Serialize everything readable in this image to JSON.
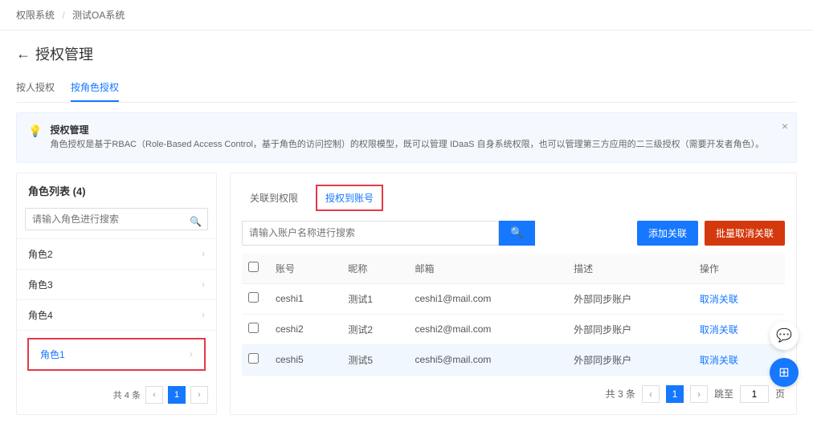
{
  "breadcrumb": {
    "item1": "权限系统",
    "item2": "测试OA系统"
  },
  "header": {
    "title": "授权管理",
    "tabs": {
      "byPerson": "按人授权",
      "byRole": "按角色授权"
    }
  },
  "info": {
    "title": "授权管理",
    "body": "角色授权是基于RBAC（Role-Based Access Control，基于角色的访问控制）的权限模型，既可以管理 IDaaS 自身系统权限，也可以管理第三方应用的二三级授权（需要开发者角色）。"
  },
  "roles": {
    "title": "角色列表",
    "count": "(4)",
    "searchPlaceholder": "请输入角色进行搜索",
    "items": [
      {
        "name": "角色2"
      },
      {
        "name": "角色3"
      },
      {
        "name": "角色4"
      },
      {
        "name": "角色1"
      }
    ],
    "total": "共 4 条"
  },
  "right": {
    "tabs": {
      "toPerm": "关联到权限",
      "toAccount": "授权到账号"
    },
    "searchPlaceholder": "请输入账户名称进行搜索",
    "addBtn": "添加关联",
    "batchCancel": "批量取消关联",
    "columns": {
      "acct": "账号",
      "nick": "昵称",
      "email": "邮箱",
      "desc": "描述",
      "op": "操作"
    },
    "rows": [
      {
        "acct": "ceshi1",
        "nick": "测试1",
        "email": "ceshi1@mail.com",
        "desc": "外部同步账户",
        "op": "取消关联"
      },
      {
        "acct": "ceshi2",
        "nick": "测试2",
        "email": "ceshi2@mail.com",
        "desc": "外部同步账户",
        "op": "取消关联"
      },
      {
        "acct": "ceshi5",
        "nick": "测试5",
        "email": "ceshi5@mail.com",
        "desc": "外部同步账户",
        "op": "取消关联"
      }
    ],
    "total": "共 3 条",
    "jumpLabel": "跳至",
    "jumpValue": "1",
    "pageSuffix": "页"
  },
  "pager": {
    "page1": "1"
  }
}
